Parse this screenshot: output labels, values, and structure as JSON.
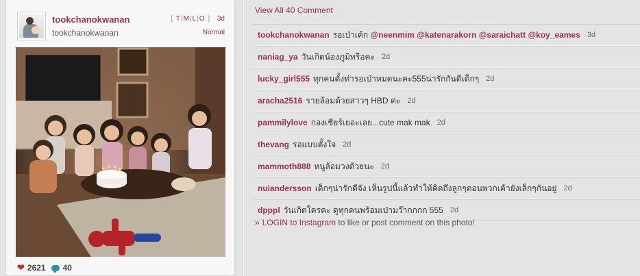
{
  "post": {
    "username": "tookchanokwanan",
    "fullname": "tookchanokwanan",
    "filter_links": [
      "T",
      "M",
      "L",
      "O"
    ],
    "time": "3d",
    "filter_name": "Normal",
    "likes": "2621",
    "comments_count": "40"
  },
  "comments_panel": {
    "view_all": "View All 40 Comment",
    "items": [
      {
        "user": "tookchanokwanan",
        "text": "รอเป่าเค้ก",
        "mentions": [
          "@neenmim",
          "@katenarakorn",
          "@saraichatt",
          "@koy_eames"
        ],
        "time": "3d"
      },
      {
        "user": "naniag_ya",
        "text": "วันเกิดน้องภูมิหรือคะ",
        "time": "2d"
      },
      {
        "user": "lucky_girl555",
        "text": "ทุกคนตั้งท่ารอเป่าหมดนะคะ555น่ารักกันดีเด็กๆ",
        "time": "2d"
      },
      {
        "user": "aracha2516",
        "text": "รายล้อมด้วยสาวๆ HBD ค่ะ",
        "time": "2d"
      },
      {
        "user": "pammilylove",
        "text": "กองเชียร์เยอะเลย...cute mak mak",
        "time": "2d"
      },
      {
        "user": "thevang",
        "text": "รอแบบตั้งใจ",
        "time": "2d"
      },
      {
        "user": "mammoth888",
        "text": "หนูล้อมวงด้วยนะ",
        "time": "2d"
      },
      {
        "user": "nuiandersson",
        "text": "เด็กๆน่ารักดีจัง เห็นรูปนี้แล้วทำให้คิดถึงลูกๆตอนพวกเค้ายังเล็กๆกันอยู่",
        "time": "2d"
      },
      {
        "user": "dpppl",
        "text": "วันเกิดใครคะ ดูทุกคนพร้อมเป่ามว๊ากกกก 555",
        "time": "2d"
      }
    ],
    "login_prefix": "»",
    "login_link": "LOGIN to Instagram",
    "login_suffix": " to like or post comment on this photo!"
  },
  "colors": {
    "accent": "#9b2f57",
    "like_heart": "#c0302e",
    "comment_bubble": "#2c8ea6",
    "background": "#e4e4e4"
  },
  "icons": {
    "like": "heart-icon",
    "comment": "speech-bubble-icon"
  }
}
